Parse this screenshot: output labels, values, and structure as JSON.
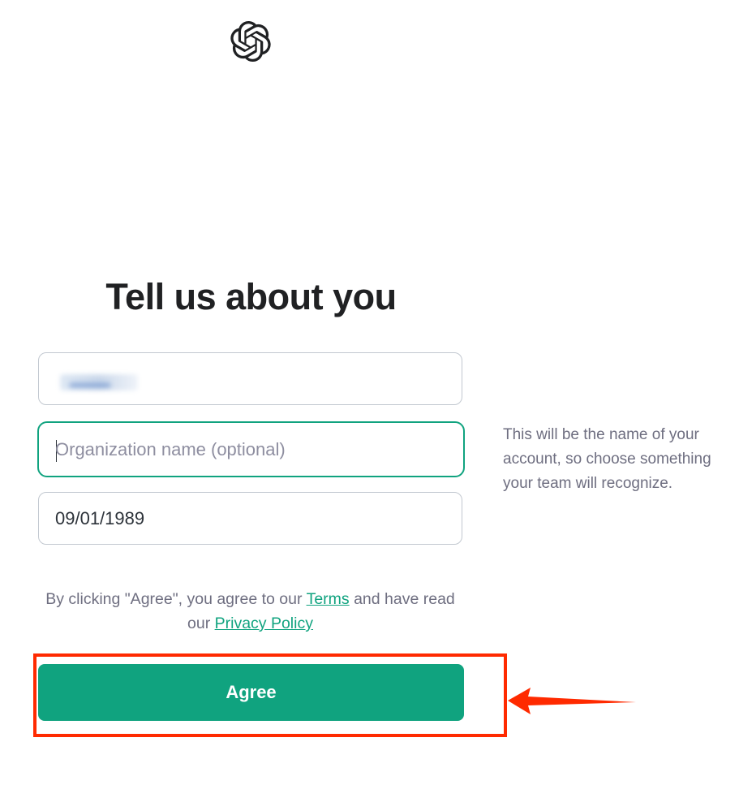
{
  "header": {
    "logo_icon": "openai-logo-icon"
  },
  "form": {
    "title": "Tell us about you",
    "name_value": "",
    "organization_placeholder": "Organization name (optional)",
    "organization_value": "",
    "birthday_value": "09/01/1989",
    "helper_text": "This will be the name of your account, so choose something your team will recognize.",
    "legal": {
      "prefix": "By clicking \"Agree\", you agree to our ",
      "terms_link": "Terms",
      "middle": " and have read our ",
      "privacy_link": "Privacy Policy"
    },
    "agree_label": "Agree"
  },
  "colors": {
    "accent": "#10a37f",
    "annotation": "#ff2a00",
    "muted_text": "#6e6e80",
    "border": "#c2c8d0"
  },
  "annotations": {
    "highlight": "red-box-around-agree-button",
    "arrow_icon": "left-arrow-icon"
  }
}
